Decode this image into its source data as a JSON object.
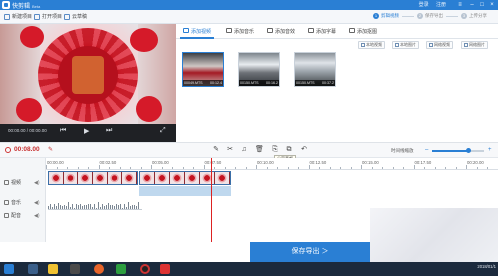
{
  "titlebar": {
    "title": "快剪辑",
    "badge": "Beta",
    "login": "登录",
    "register": "注册"
  },
  "menu": {
    "new_project": "新建项目",
    "open_project": "打开项目",
    "cloud_draft": "云草稿"
  },
  "steps": [
    {
      "n": "1",
      "label": "剪辑视频",
      "active": true
    },
    {
      "n": "2",
      "label": "保存导出",
      "active": false
    },
    {
      "n": "3",
      "label": "上传分享",
      "active": false
    }
  ],
  "preview": {
    "time": "00:00.00 / 00:00.00"
  },
  "tabs": [
    {
      "label": "添加视频",
      "active": true
    },
    {
      "label": "添加音乐",
      "active": false
    },
    {
      "label": "添加音效",
      "active": false
    },
    {
      "label": "添加字幕",
      "active": false
    },
    {
      "label": "添加抠图",
      "active": false
    }
  ],
  "media_tools": {
    "local_video": "本地视频",
    "local_image": "本地图片",
    "online_video": "网络视频",
    "online_image": "网络图片"
  },
  "thumbs": [
    {
      "name": "00049.MTS",
      "duration": "00:12.4"
    },
    {
      "name": "00150.MTS",
      "duration": "00:16.2"
    },
    {
      "name": "00150.MTS",
      "duration": "00:37.2"
    }
  ],
  "timeline": {
    "current_time": "00:08.00",
    "tooltip": "分离音频",
    "zoom_label": "时间线缩放",
    "zoom_level": 0.7,
    "ruler": [
      "00:00.00",
      "00:02.50",
      "00:05.00",
      "00:07.50",
      "00:10.00",
      "00:12.50",
      "00:15.00",
      "00:17.50",
      "00:20.00"
    ]
  },
  "tracks": {
    "video": "视频",
    "music": "音乐",
    "voice": "配音"
  },
  "save": {
    "label": "保存导出 ＞"
  },
  "taskbar": {
    "clock_time": "",
    "clock_date": "2018/01/1"
  },
  "colors": {
    "brand": "#2a7fd4",
    "current_time": "#c83030"
  }
}
